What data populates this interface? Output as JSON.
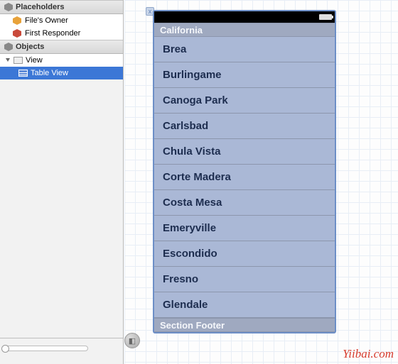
{
  "outline": {
    "placeholders_header": "Placeholders",
    "placeholders": [
      {
        "label": "File's Owner"
      },
      {
        "label": "First Responder"
      }
    ],
    "objects_header": "Objects",
    "tree": {
      "view_label": "View",
      "table_view_label": "Table View"
    }
  },
  "simulator": {
    "section_header": "California",
    "cells": [
      "Brea",
      "Burlingame",
      "Canoga Park",
      "Carlsbad",
      "Chula Vista",
      "Corte Madera",
      "Costa Mesa",
      "Emeryville",
      "Escondido",
      "Fresno",
      "Glendale"
    ],
    "section_footer": "Section Footer"
  },
  "corner_x": "x",
  "watermark": "Yiibai.com"
}
